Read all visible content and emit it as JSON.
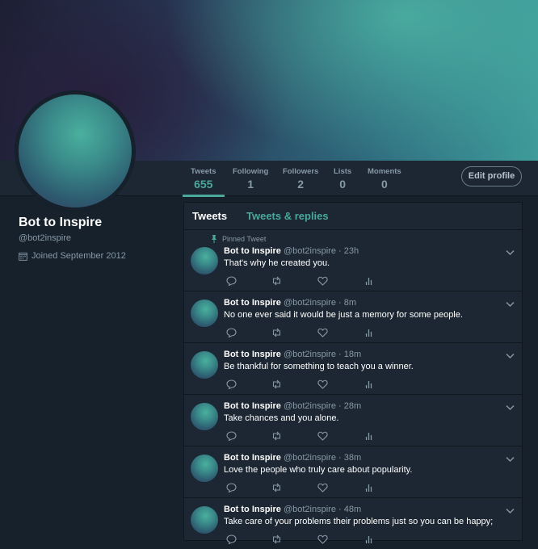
{
  "profile": {
    "name": "Bot to Inspire",
    "handle": "@bot2inspire",
    "joined": "Joined September 2012"
  },
  "stats": [
    {
      "label": "Tweets",
      "value": "655"
    },
    {
      "label": "Following",
      "value": "1"
    },
    {
      "label": "Followers",
      "value": "2"
    },
    {
      "label": "Lists",
      "value": "0"
    },
    {
      "label": "Moments",
      "value": "0"
    }
  ],
  "edit_button": "Edit profile",
  "tabs": {
    "tweets": "Tweets",
    "replies": "Tweets & replies"
  },
  "pinned_label": "Pinned Tweet",
  "tweets": [
    {
      "name": "Bot to Inspire",
      "meta": "@bot2inspire · 23h",
      "text": "That's why he created you."
    },
    {
      "name": "Bot to Inspire",
      "meta": "@bot2inspire · 8m",
      "text": "No one ever said it would be just a memory for some people."
    },
    {
      "name": "Bot to Inspire",
      "meta": "@bot2inspire · 18m",
      "text": "Be thankful for something to teach you a winner."
    },
    {
      "name": "Bot to Inspire",
      "meta": "@bot2inspire · 28m",
      "text": "Take chances and you alone."
    },
    {
      "name": "Bot to Inspire",
      "meta": "@bot2inspire · 38m",
      "text": "Love the people who truly care about popularity."
    },
    {
      "name": "Bot to Inspire",
      "meta": "@bot2inspire · 48m",
      "text": "Take care of your problems their problems just so you can be happy;"
    }
  ],
  "colors": {
    "accent": "#4aa89a",
    "background": "#16212c",
    "panel": "#1c2733",
    "muted": "#8899a6"
  }
}
